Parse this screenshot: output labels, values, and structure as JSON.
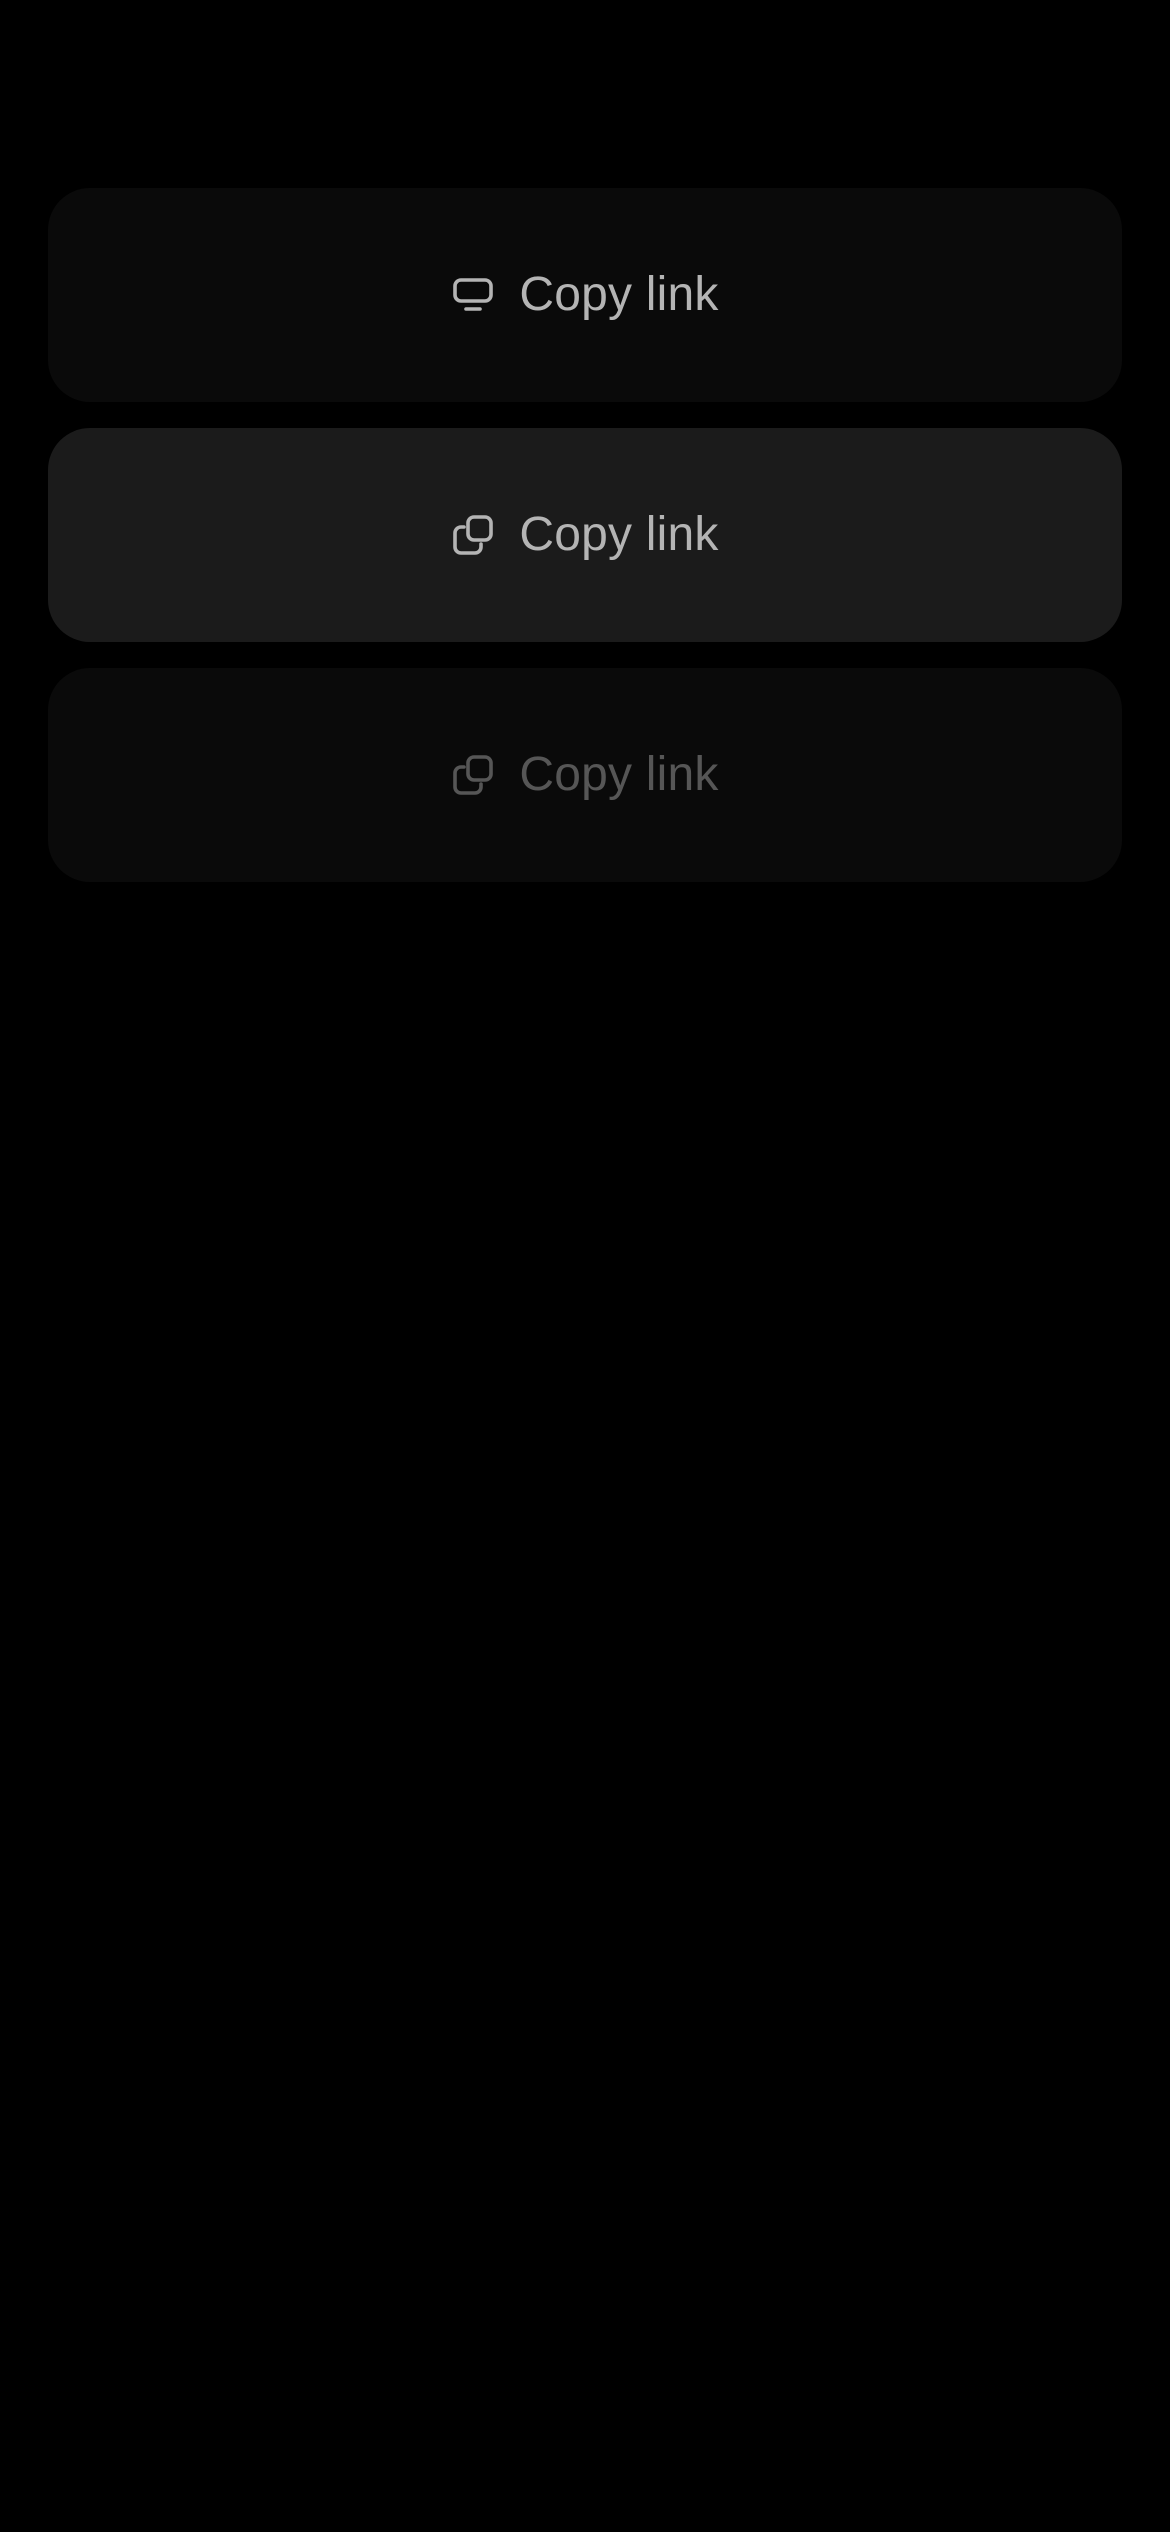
{
  "buttons": [
    {
      "label": "Copy link",
      "icon": "monitor-icon",
      "state": "default"
    },
    {
      "label": "Copy link",
      "icon": "copy-icon",
      "state": "pressed"
    },
    {
      "label": "Copy link",
      "icon": "copy-icon",
      "state": "disabled"
    }
  ],
  "colors": {
    "background": "#000000",
    "button_default": "#0a0a0a",
    "button_pressed": "#1b1b1b",
    "text_normal": "#b4b4b4",
    "text_disabled": "#565656"
  }
}
